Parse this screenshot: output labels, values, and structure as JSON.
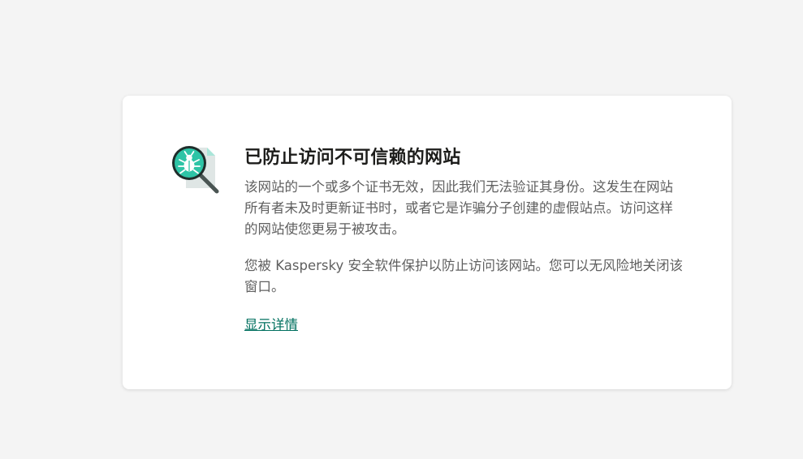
{
  "alert": {
    "title": "已防止访问不可信赖的网站",
    "paragraph1": "该网站的一个或多个证书无效，因此我们无法验证其身份。这发生在网站所有者未及时更新证书时，或者它是诈骗分子创建的虚假站点。访问这样的网站使您更易于被攻击。",
    "paragraph2": "您被 Kaspersky 安全软件保护以防止访问该网站。您可以无风险地关闭该窗口。",
    "details_link": "显示详情",
    "icon": "bug-magnifier-icon"
  },
  "colors": {
    "accent": "#00a88e",
    "link": "#00705f",
    "title": "#1d1d1b",
    "text": "#5f5f5f",
    "background": "#f4f4f4",
    "card": "#ffffff"
  }
}
